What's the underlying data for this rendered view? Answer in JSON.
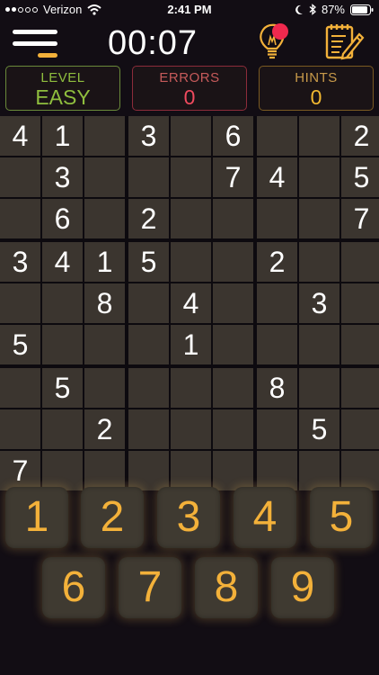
{
  "status_bar": {
    "carrier": "Verizon",
    "time": "2:41 PM",
    "battery": "87%"
  },
  "header": {
    "timer": "00:07"
  },
  "stats": [
    {
      "label": "LEVEL",
      "value": "EASY"
    },
    {
      "label": "ERRORS",
      "value": "0"
    },
    {
      "label": "HINTS",
      "value": "0"
    }
  ],
  "board": {
    "rows": [
      [
        "4",
        "1",
        "",
        "3",
        "",
        "6",
        "",
        "",
        "2"
      ],
      [
        "",
        "3",
        "",
        "",
        "",
        "7",
        "4",
        "",
        "5"
      ],
      [
        "",
        "6",
        "",
        "2",
        "",
        "",
        "",
        "",
        "7"
      ],
      [
        "3",
        "4",
        "1",
        "5",
        "",
        "",
        "2",
        "",
        ""
      ],
      [
        "",
        "",
        "8",
        "",
        "4",
        "",
        "",
        "3",
        ""
      ],
      [
        "5",
        "",
        "",
        "",
        "1",
        "",
        "",
        "",
        ""
      ],
      [
        "",
        "5",
        "",
        "",
        "",
        "",
        "8",
        "",
        ""
      ],
      [
        "",
        "",
        "2",
        "",
        "",
        "",
        "",
        "5",
        ""
      ],
      [
        "7",
        "",
        "",
        "",
        "",
        "",
        "",
        "",
        ""
      ]
    ]
  },
  "number_pad": [
    "1",
    "2",
    "3",
    "4",
    "5",
    "6",
    "7",
    "8",
    "9"
  ],
  "colors": {
    "accent": "#f3b13a",
    "level": "#8fbe3e",
    "errors": "#f04a5e",
    "hints": "#f2b830",
    "notification": "#f0294e"
  },
  "icons": [
    "wifi-icon",
    "moon-icon",
    "bluetooth-icon",
    "battery-icon",
    "menu-icon",
    "lightbulb-icon",
    "notepad-pencil-icon"
  ]
}
